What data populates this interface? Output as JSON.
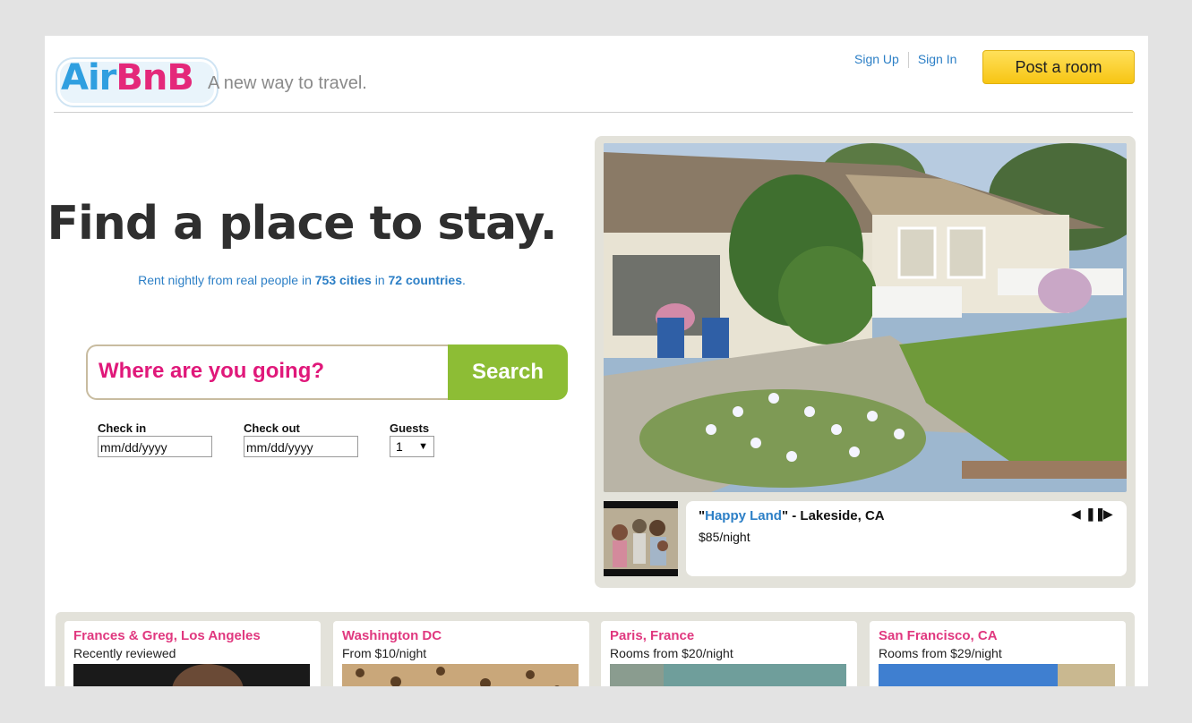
{
  "brand": {
    "logo_air": "Air",
    "logo_bnb": "BnB",
    "tagline": "A new way to travel."
  },
  "header": {
    "sign_up": "Sign Up",
    "sign_in": "Sign In",
    "post_room": "Post a room"
  },
  "hero": {
    "title": "Find a place to stay.",
    "sub_prefix": "Rent nightly from real people in ",
    "cities": "753 cities",
    "sub_mid": " in ",
    "countries": "72 countries",
    "sub_suffix": ".",
    "search_placeholder": "Where are you going?",
    "search_button": "Search",
    "checkin_label": "Check in",
    "checkin_value": "mm/dd/yyyy",
    "checkout_label": "Check out",
    "checkout_value": "mm/dd/yyyy",
    "guests_label": "Guests",
    "guests_value": "1"
  },
  "featured": {
    "quote_open": "\"",
    "name": "Happy Land",
    "quote_close": "\"",
    "location": " - Lakeside, CA",
    "price": "$85/night",
    "controls": {
      "prev": "prev-icon",
      "pause": "pause-icon",
      "next": "next-icon"
    }
  },
  "cards": [
    {
      "title": "Frances & Greg, Los Angeles",
      "sub": "Recently reviewed"
    },
    {
      "title": "Washington DC",
      "sub": "From $10/night"
    },
    {
      "title": "Paris, France",
      "sub": "Rooms from $20/night"
    },
    {
      "title": "San Francisco, CA",
      "sub": "Rooms from $29/night"
    }
  ],
  "colors": {
    "brand_blue": "#2f9fe0",
    "brand_pink": "#e4287a",
    "search_green": "#8dbd35",
    "post_yellow": "#f7c513",
    "link_blue": "#2c7fc6"
  }
}
